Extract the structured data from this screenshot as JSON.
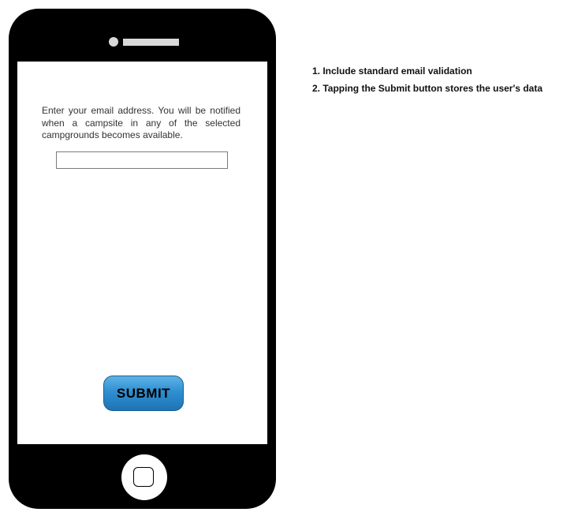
{
  "screen": {
    "instruction_text": "Enter your email address. You will be notified when a campsite in any of the selected campgrounds becomes available.",
    "email_input": {
      "value": "",
      "placeholder": ""
    },
    "submit_label": "SUBMIT"
  },
  "device": {
    "home_icon": "home-square-icon",
    "speaker_icon": "speaker-icon",
    "camera_icon": "camera-dot-icon"
  },
  "notes": [
    "1. Include standard email validation",
    "2. Tapping the Submit button stores the user's data"
  ],
  "colors": {
    "phone_body": "#000000",
    "button_gradient_top": "#5fb3e8",
    "button_gradient_bottom": "#1e73b5",
    "button_border": "#1c5f8f"
  }
}
